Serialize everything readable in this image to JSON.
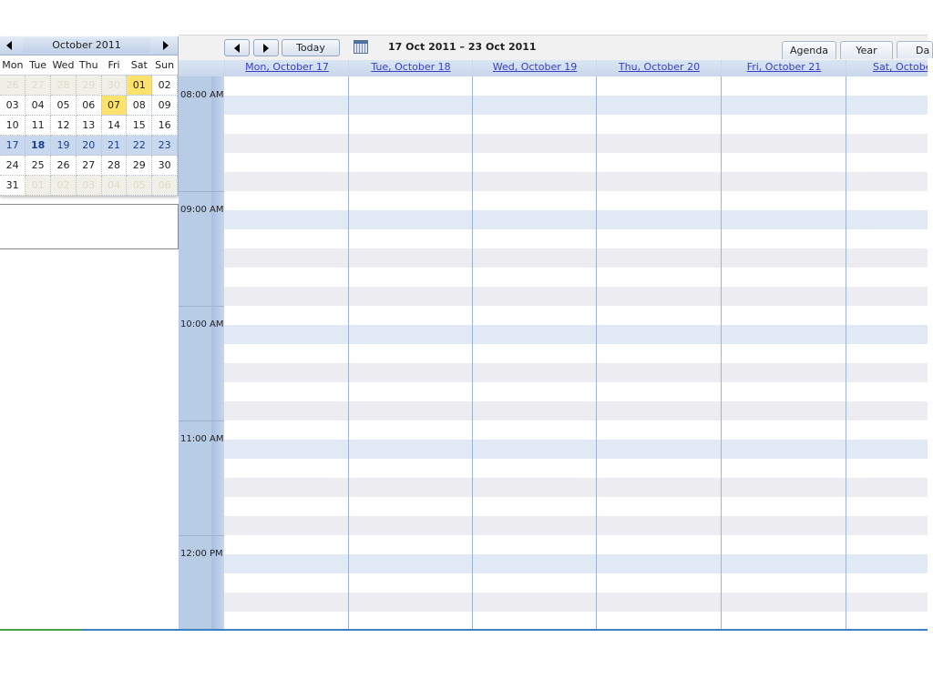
{
  "mini_calendar": {
    "month_title": "October 2011",
    "weekdays": [
      "Mon",
      "Tue",
      "Wed",
      "Thu",
      "Fri",
      "Sat",
      "Sun"
    ],
    "weeks": [
      [
        {
          "d": "26",
          "c": "other"
        },
        {
          "d": "27",
          "c": "other"
        },
        {
          "d": "28",
          "c": "other"
        },
        {
          "d": "29",
          "c": "other"
        },
        {
          "d": "30",
          "c": "other"
        },
        {
          "d": "01",
          "c": "hl"
        },
        {
          "d": "02",
          "c": ""
        }
      ],
      [
        {
          "d": "03",
          "c": ""
        },
        {
          "d": "04",
          "c": ""
        },
        {
          "d": "05",
          "c": ""
        },
        {
          "d": "06",
          "c": ""
        },
        {
          "d": "07",
          "c": "hl"
        },
        {
          "d": "08",
          "c": ""
        },
        {
          "d": "09",
          "c": ""
        }
      ],
      [
        {
          "d": "10",
          "c": ""
        },
        {
          "d": "11",
          "c": ""
        },
        {
          "d": "12",
          "c": ""
        },
        {
          "d": "13",
          "c": ""
        },
        {
          "d": "14",
          "c": ""
        },
        {
          "d": "15",
          "c": ""
        },
        {
          "d": "16",
          "c": ""
        }
      ],
      [
        {
          "d": "17",
          "c": ""
        },
        {
          "d": "18",
          "c": "today"
        },
        {
          "d": "19",
          "c": ""
        },
        {
          "d": "20",
          "c": ""
        },
        {
          "d": "21",
          "c": ""
        },
        {
          "d": "22",
          "c": ""
        },
        {
          "d": "23",
          "c": ""
        }
      ],
      [
        {
          "d": "24",
          "c": ""
        },
        {
          "d": "25",
          "c": ""
        },
        {
          "d": "26",
          "c": ""
        },
        {
          "d": "27",
          "c": ""
        },
        {
          "d": "28",
          "c": ""
        },
        {
          "d": "29",
          "c": ""
        },
        {
          "d": "30",
          "c": ""
        }
      ],
      [
        {
          "d": "31",
          "c": ""
        },
        {
          "d": "01",
          "c": "other"
        },
        {
          "d": "02",
          "c": "other"
        },
        {
          "d": "03",
          "c": "other"
        },
        {
          "d": "04",
          "c": "other"
        },
        {
          "d": "05",
          "c": "other"
        },
        {
          "d": "06",
          "c": "other"
        }
      ]
    ],
    "selected_week_index": 3
  },
  "toolbar": {
    "today_label": "Today",
    "range_title": "17 Oct 2011 – 23 Oct 2011",
    "view_tabs": [
      "Agenda",
      "Year",
      "Da"
    ]
  },
  "day_headers": [
    "Mon, October 17",
    "Tue, October 18",
    "Wed, October 19",
    "Thu, October 20",
    "Fri, October 21",
    "Sat, October"
  ],
  "hours": [
    "08:00 AM",
    "09:00 AM",
    "10:00 AM",
    "11:00 AM",
    "12:00 PM"
  ],
  "icons": {
    "prev": "triangle-left-icon",
    "next": "triangle-right-icon",
    "calendar": "calendar-icon"
  },
  "colors": {
    "highlight_day": "#ffe26b",
    "selected_week": "#c8d8ef",
    "header_blue": "#c8d7ec",
    "link": "#3a3fc0"
  }
}
